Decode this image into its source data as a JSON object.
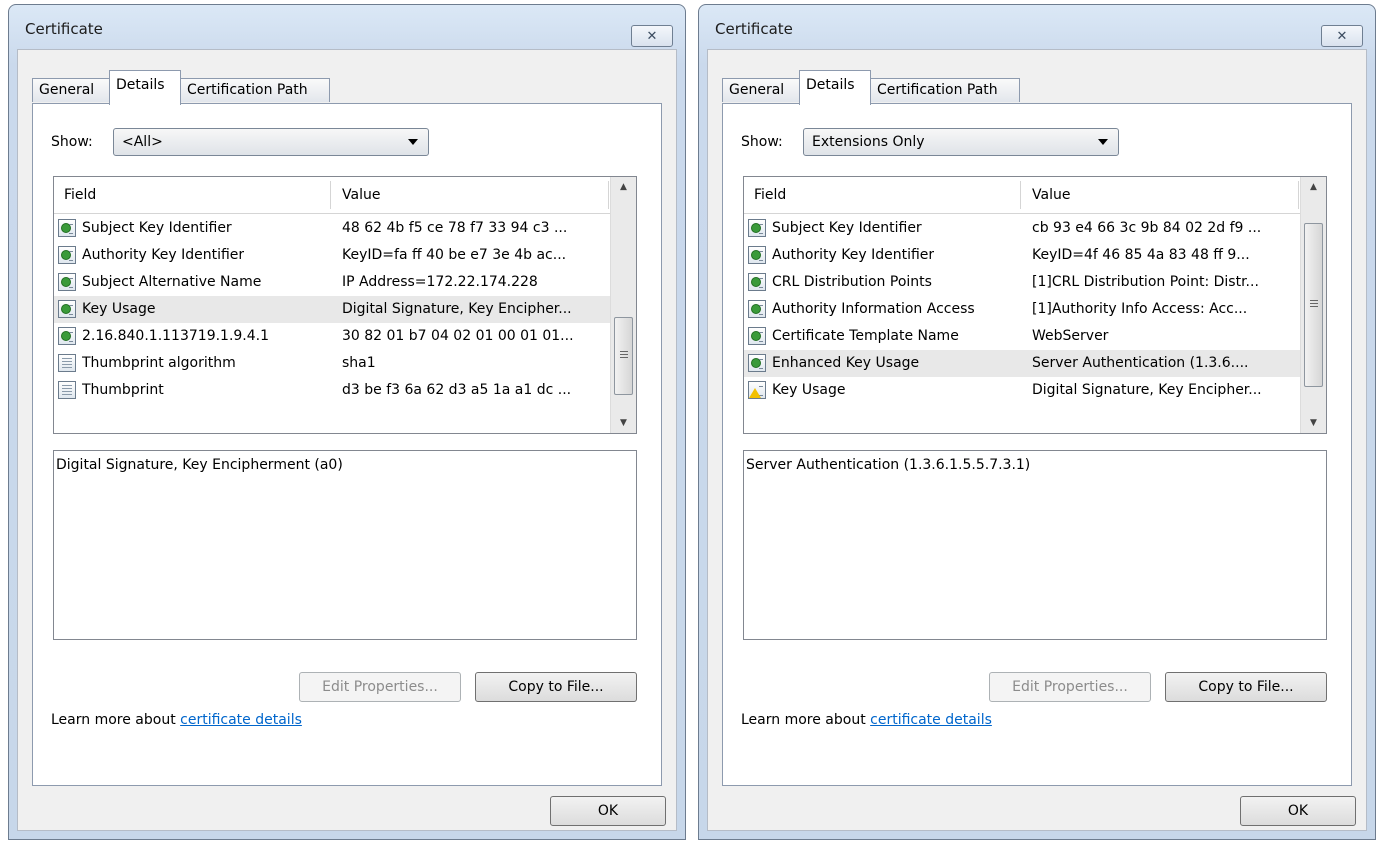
{
  "dialogs": [
    {
      "title": "Certificate",
      "tabs": [
        "General",
        "Details",
        "Certification Path"
      ],
      "active_tab": "Details",
      "show_label": "Show:",
      "show_value": "<All>",
      "columns": [
        "Field",
        "Value"
      ],
      "rows": [
        {
          "field": "Subject Key Identifier",
          "value": "48 62 4b f5 ce 78 f7 33 94 c3 ...",
          "icon": "extension-icon"
        },
        {
          "field": "Authority Key Identifier",
          "value": "KeyID=fa ff 40 be e7 3e 4b ac...",
          "icon": "extension-icon"
        },
        {
          "field": "Subject Alternative Name",
          "value": "IP Address=172.22.174.228",
          "icon": "extension-icon"
        },
        {
          "field": "Key Usage",
          "value": "Digital Signature, Key Encipher...",
          "icon": "extension-icon",
          "selected": true
        },
        {
          "field": "2.16.840.1.113719.1.9.4.1",
          "value": "30 82 01 b7 04 02 01 00 01 01...",
          "icon": "extension-icon"
        },
        {
          "field": "Thumbprint algorithm",
          "value": "sha1",
          "icon": "property-icon"
        },
        {
          "field": "Thumbprint",
          "value": "d3 be f3 6a 62 d3 a5 1a a1 dc ...",
          "icon": "property-icon"
        }
      ],
      "detail_text": "Digital Signature, Key Encipherment (a0)",
      "edit_properties_label": "Edit Properties...",
      "copy_to_file_label": "Copy to File...",
      "learn_more_text": "Learn more about",
      "learn_more_link": "certificate details",
      "ok_label": "OK"
    },
    {
      "title": "Certificate",
      "tabs": [
        "General",
        "Details",
        "Certification Path"
      ],
      "active_tab": "Details",
      "show_label": "Show:",
      "show_value": "Extensions Only",
      "columns": [
        "Field",
        "Value"
      ],
      "rows": [
        {
          "field": "Subject Key Identifier",
          "value": "cb 93 e4 66 3c 9b 84 02 2d f9 ...",
          "icon": "extension-icon"
        },
        {
          "field": "Authority Key Identifier",
          "value": "KeyID=4f 46 85 4a 83 48 ff 9...",
          "icon": "extension-icon"
        },
        {
          "field": "CRL Distribution Points",
          "value": "[1]CRL Distribution Point: Distr...",
          "icon": "extension-icon"
        },
        {
          "field": "Authority Information Access",
          "value": "[1]Authority Info Access: Acc...",
          "icon": "extension-icon"
        },
        {
          "field": "Certificate Template Name",
          "value": "WebServer",
          "icon": "extension-icon"
        },
        {
          "field": "Enhanced Key Usage",
          "value": "Server Authentication (1.3.6....",
          "icon": "extension-icon",
          "selected": true
        },
        {
          "field": "Key Usage",
          "value": "Digital Signature, Key Encipher...",
          "icon": "critical-extension-icon"
        }
      ],
      "detail_text": "Server Authentication (1.3.6.1.5.5.7.3.1)",
      "edit_properties_label": "Edit Properties...",
      "copy_to_file_label": "Copy to File...",
      "learn_more_text": "Learn more about",
      "learn_more_link": "certificate details",
      "ok_label": "OK"
    }
  ]
}
